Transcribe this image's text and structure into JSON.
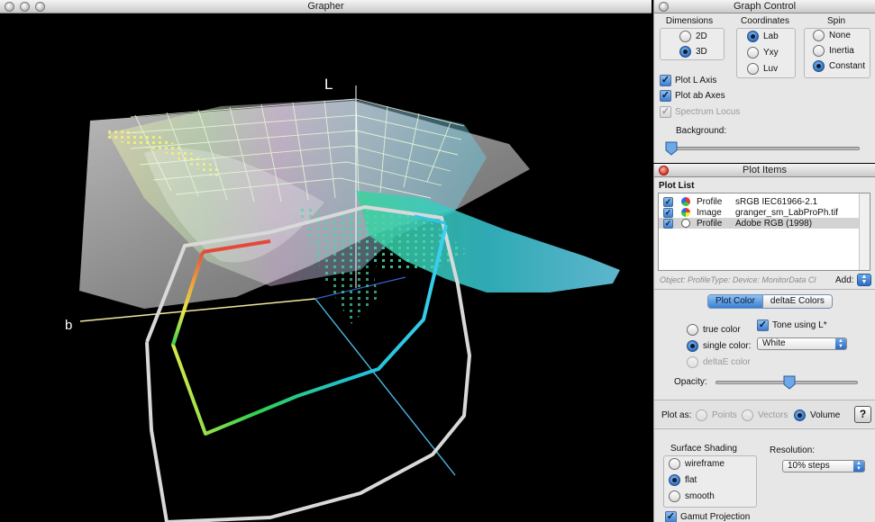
{
  "grapher": {
    "title": "Grapher",
    "axis_L": "L",
    "axis_b": "b"
  },
  "graph_control": {
    "title": "Graph Control",
    "dimensions": {
      "label": "Dimensions",
      "options": [
        "2D",
        "3D"
      ],
      "selected": "3D"
    },
    "coordinates": {
      "label": "Coordinates",
      "options": [
        "Lab",
        "Yxy",
        "Luv"
      ],
      "selected": "Lab"
    },
    "spin": {
      "label": "Spin",
      "options": [
        "None",
        "Inertia",
        "Constant"
      ],
      "selected": "Constant"
    },
    "plot_l_axis": "Plot L Axis",
    "plot_ab_axes": "Plot ab Axes",
    "spectrum_locus": "Spectrum Locus",
    "background_label": "Background:",
    "background_value": 0.05
  },
  "plot_items": {
    "title": "Plot Items",
    "plot_list_label": "Plot List",
    "rows": [
      {
        "type": "Profile",
        "name": "sRGB IEC61966-2.1",
        "checked": true,
        "selected": false
      },
      {
        "type": "Image",
        "name": "granger_sm_LabProPh.tif",
        "checked": true,
        "selected": false
      },
      {
        "type": "Profile",
        "name": "Adobe RGB (1998)",
        "checked": true,
        "selected": true
      }
    ],
    "status_line": "Object: ProfileType: Device: MonitorData Cl",
    "add_label": "Add:",
    "tabs": [
      "Plot Color",
      "deltaE Colors"
    ],
    "active_tab": "Plot Color",
    "true_color": "true color",
    "single_color": "single color:",
    "deltae_color": "deltaE color",
    "tone_using_l": "Tone using L*",
    "single_color_value": "White",
    "opacity_label": "Opacity:",
    "opacity_value": 0.5,
    "plot_as_label": "Plot as:",
    "plot_as_options": [
      "Points",
      "Vectors",
      "Volume"
    ],
    "plot_as_selected": "Volume",
    "help_label": "?",
    "surface_shading": {
      "label": "Surface Shading",
      "options": [
        "wireframe",
        "flat",
        "smooth"
      ],
      "selected": "flat"
    },
    "resolution_label": "Resolution:",
    "resolution_value": "10% steps",
    "gamut_projection": "Gamut Projection"
  }
}
